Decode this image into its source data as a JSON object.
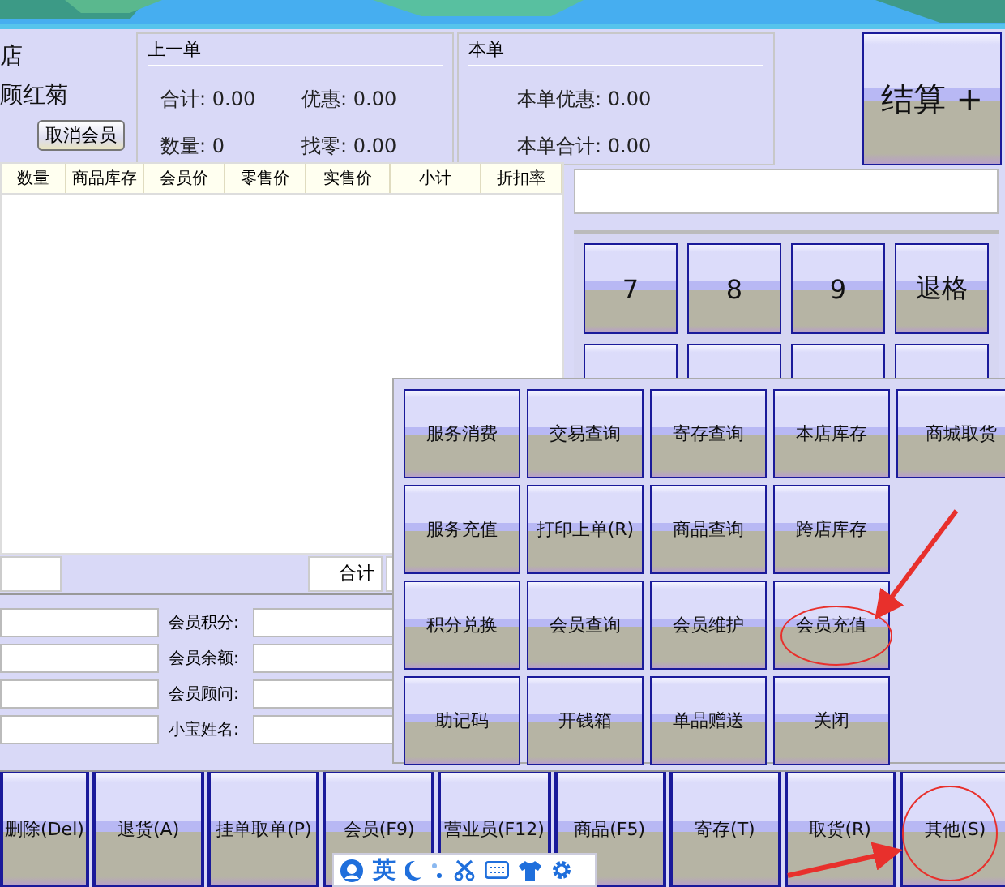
{
  "store": {
    "name": "店",
    "member": "顾红菊",
    "cancel_button": "取消会员"
  },
  "last_order": {
    "title": "上一单",
    "fields": [
      {
        "label": "合计:",
        "value": "0.00"
      },
      {
        "label": "优惠:",
        "value": "0.00"
      },
      {
        "label": "数量:",
        "value": "0"
      },
      {
        "label": "找零:",
        "value": "0.00"
      }
    ]
  },
  "this_order": {
    "title": "本单",
    "fields": [
      {
        "label": "本单优惠:",
        "value": "0.00"
      },
      {
        "label": "本单合计:",
        "value": "0.00"
      }
    ]
  },
  "checkout_button": "结算 +",
  "table": {
    "columns": [
      "数量",
      "商品库存",
      "会员价",
      "零售价",
      "实售价",
      "小计",
      "折扣率"
    ]
  },
  "total_label": "合计",
  "member_fields": [
    "会员积分:",
    "会员余额:",
    "会员顾问:",
    "小宝姓名:"
  ],
  "keypad": [
    "7",
    "8",
    "9",
    "退格"
  ],
  "menu": {
    "buttons": [
      "服务消费",
      "交易查询",
      "寄存查询",
      "本店库存",
      "商城取货",
      "服务充值",
      "打印上单(R)",
      "商品查询",
      "跨店库存",
      "积分兑换",
      "会员查询",
      "会员维护",
      "会员充值",
      "助记码",
      "开钱箱",
      "单品赠送",
      "关闭"
    ]
  },
  "toolbar": [
    "删除(Del)",
    "退货(A)",
    "挂单取单(P)",
    "会员(F9)",
    "营业员(F12)",
    "商品(F5)",
    "寄存(T)",
    "取货(R)",
    "其他(S)"
  ],
  "ime_bar": {
    "language": "英"
  }
}
